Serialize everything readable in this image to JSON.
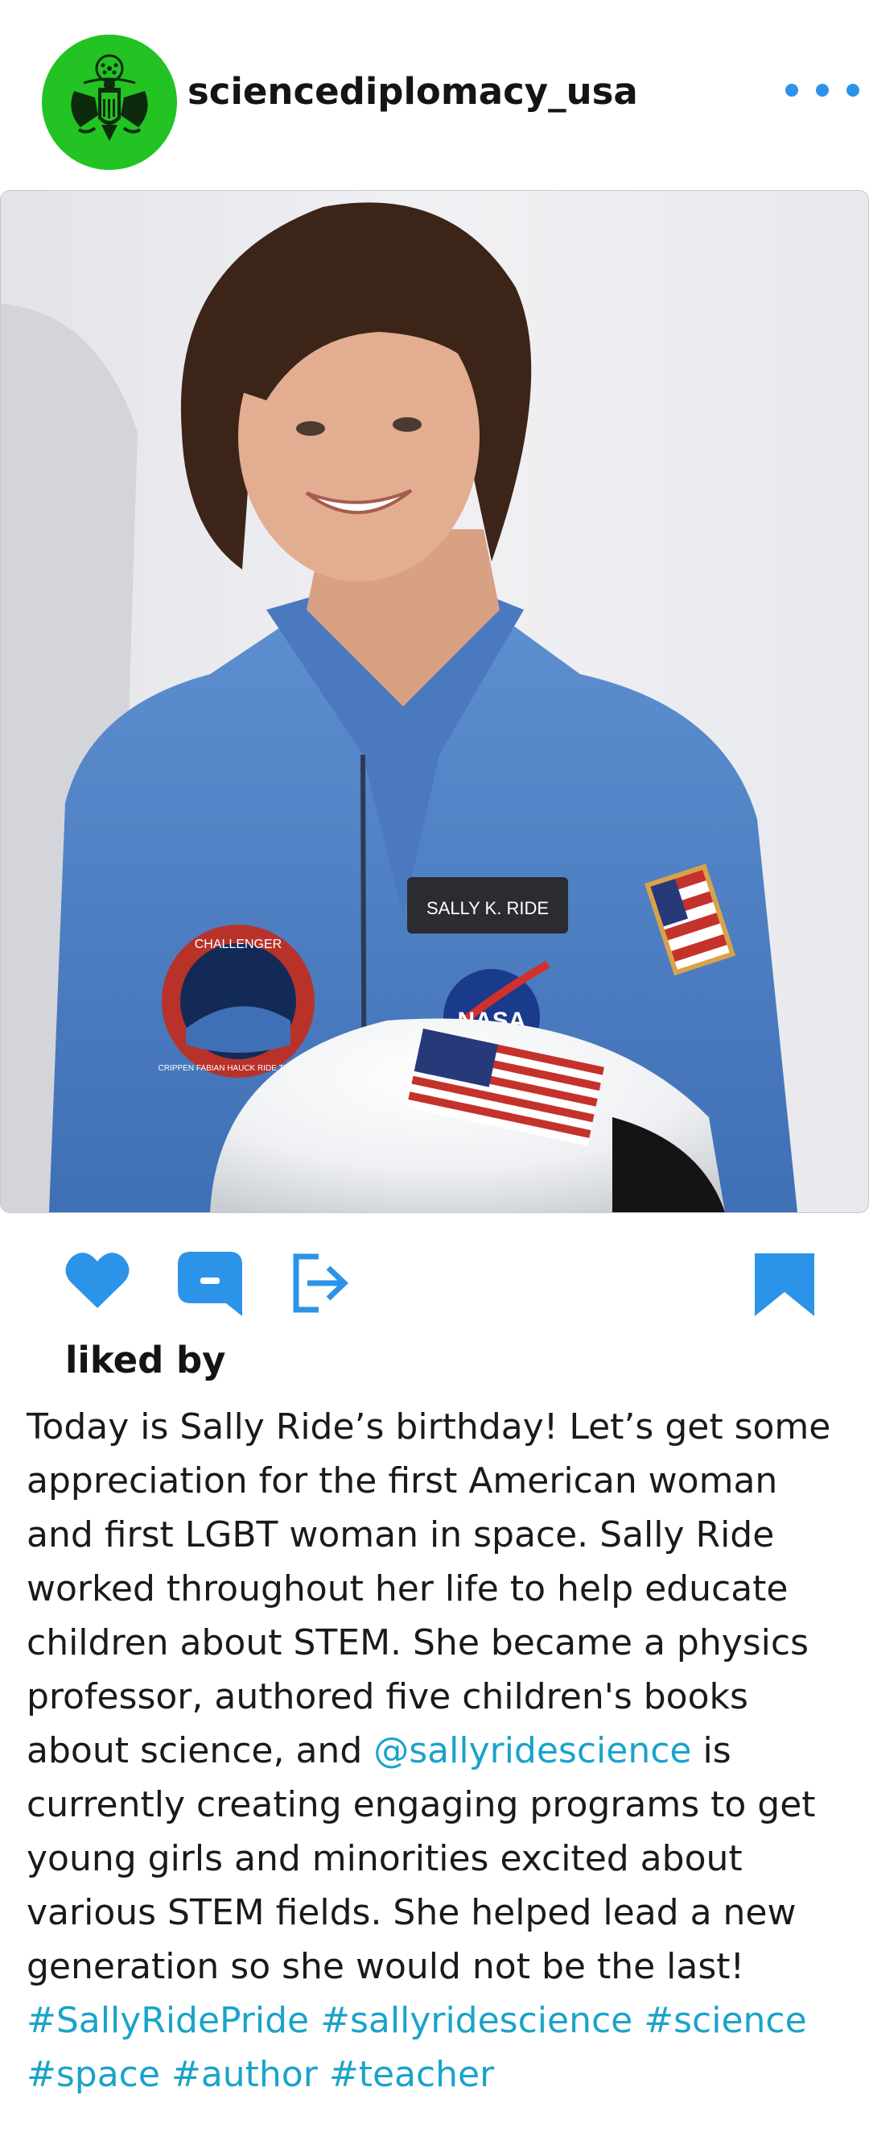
{
  "post": {
    "username": "sciencediplomacy_usa",
    "avatar_icon": "great-seal-icon",
    "avatar_color": "#22c322",
    "more_icon": "more-horizontal-icon",
    "image": {
      "name_tag": "SALLY K. RIDE",
      "nasa_logo": "NASA",
      "patch_top": "CHALLENGER",
      "patch_bottom": "CRIPPEN FABIAN HAUCK RIDE THAGARD"
    },
    "actions": {
      "like_icon": "heart-icon",
      "comment_icon": "comment-icon",
      "share_icon": "share-icon",
      "save_icon": "bookmark-icon",
      "accent_color": "#2b94e8"
    },
    "liked_by_label": "liked by",
    "caption": {
      "part1": "Today is Sally Ride’s birthday! Let’s get some appreciation for the first American woman and first LGBT woman in space. Sally Ride worked throughout her life to help educate children about STEM. She became a physics professor, authored five children's books about science, and ",
      "mention": "@sallyridescience",
      "part2": " is currently creating engaging programs to get young girls and minorities excited about various STEM fields. She helped lead a new generation so she would not be the last! ",
      "hashtags": [
        "#SallyRidePride",
        "#sallyridescience",
        "#science",
        "#space",
        "#author",
        "#teacher"
      ],
      "link_color": "#1aa3c9"
    }
  }
}
